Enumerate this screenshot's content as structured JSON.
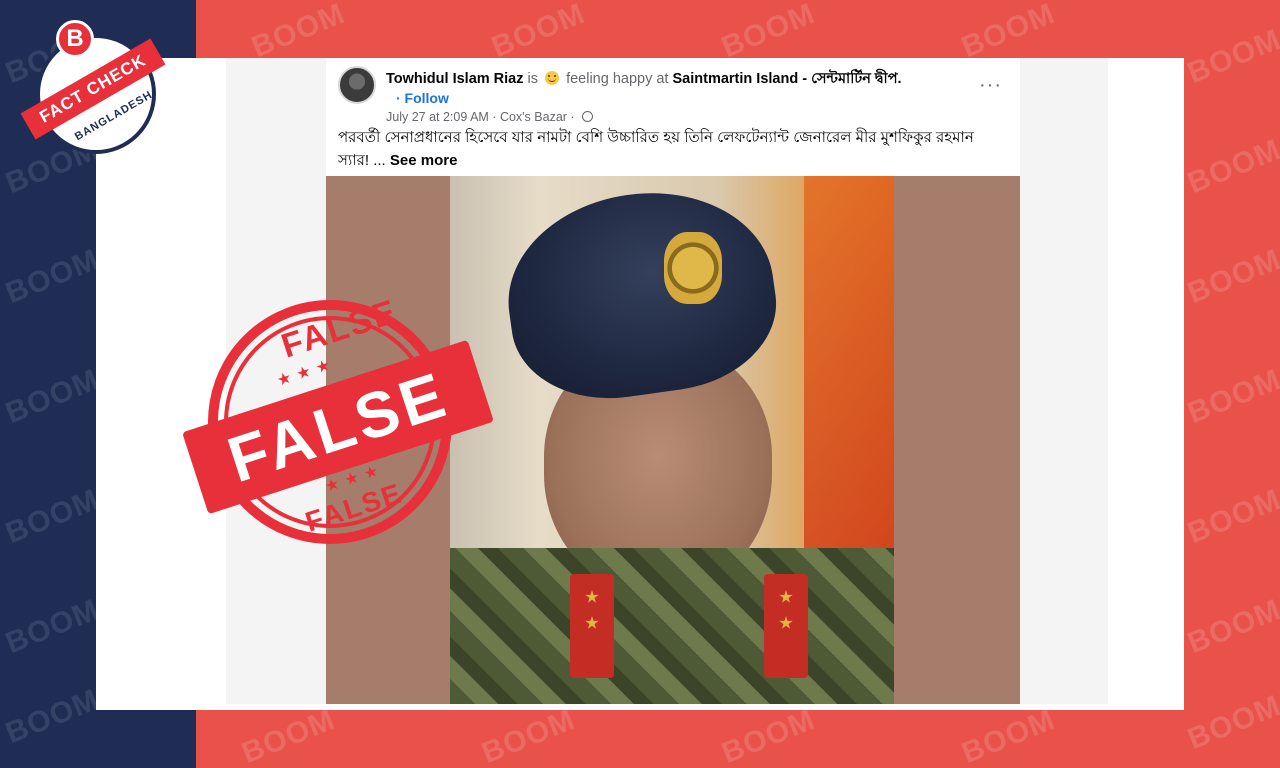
{
  "post": {
    "author": "Towhidul Islam Riaz",
    "is_word": "is",
    "feeling": "feeling happy at",
    "location": "Saintmartin Island - সেন্টমার্টিন দ্বীপ.",
    "follow": "· Follow",
    "meta": "July 27 at 2:09 AM · Cox's Bazar ·",
    "text": "পরবর্তী সেনাপ্রধানের হিসেবে যার নামটা বেশি উচ্চারিত হয় তিনি লেফটেন্যান্ট জেনারেল মীর মুশফিকুর রহমান স্যার! ...",
    "see_more": "See more",
    "more_icon": "···"
  },
  "stamp": {
    "top": "FALSE",
    "center": "FALSE",
    "bottom": "FALSE",
    "stars": "★★★"
  },
  "logo": {
    "letter": "B",
    "ribbon": "FACT CHECK",
    "country": "BANGLADESH"
  },
  "watermark": "BOOM",
  "colors": {
    "navy": "#1f2d55",
    "red": "#e8524a",
    "stamp_red": "#e8303a",
    "link_blue": "#1b74e4"
  }
}
